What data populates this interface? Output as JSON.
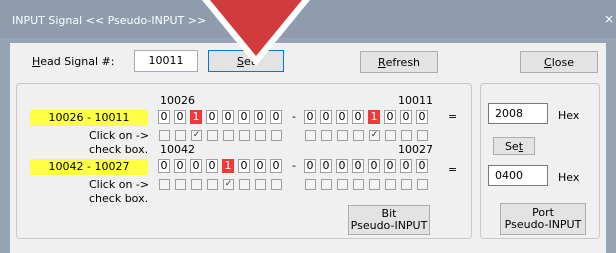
{
  "window": {
    "title": "INPUT Signal << Pseudo-INPUT >>",
    "close_glyph": "×"
  },
  "head": {
    "label_hot": "H",
    "label_rest": "ead Signal #:",
    "value": "10011",
    "set_hot": "S",
    "set_rest": "et",
    "refresh_hot": "R",
    "refresh_rest": "efresh",
    "close_hot": "C",
    "close_rest": "lose"
  },
  "rows": [
    {
      "range": "10026 - 10011",
      "left_label": "10026",
      "right_label": "10011",
      "bits_a": [
        "0",
        "0",
        "1",
        "0",
        "0",
        "0",
        "0",
        "0"
      ],
      "bits_b": [
        "0",
        "0",
        "0",
        "0",
        "1",
        "0",
        "0",
        "0"
      ],
      "on_a": [
        false,
        false,
        true,
        false,
        false,
        false,
        false,
        false
      ],
      "on_b": [
        false,
        false,
        false,
        false,
        true,
        false,
        false,
        false
      ],
      "checks_a": [
        false,
        false,
        true,
        false,
        false,
        false,
        false,
        false
      ],
      "checks_b": [
        false,
        false,
        false,
        false,
        true,
        false,
        false,
        false
      ],
      "hex": "2008"
    },
    {
      "range": "10042 - 10027",
      "left_label": "10042",
      "right_label": "10027",
      "bits_a": [
        "0",
        "0",
        "0",
        "0",
        "1",
        "0",
        "0",
        "0"
      ],
      "bits_b": [
        "0",
        "0",
        "0",
        "0",
        "0",
        "0",
        "0",
        "0"
      ],
      "on_a": [
        false,
        false,
        false,
        false,
        true,
        false,
        false,
        false
      ],
      "on_b": [
        false,
        false,
        false,
        false,
        false,
        false,
        false,
        false
      ],
      "checks_a": [
        false,
        false,
        false,
        false,
        true,
        false,
        false,
        false
      ],
      "checks_b": [
        false,
        false,
        false,
        false,
        false,
        false,
        false,
        false
      ],
      "hex": "0400"
    }
  ],
  "click_on": "Click on ->",
  "check_box": "check box.",
  "dash": "-",
  "equals": "=",
  "hex_unit": "Hex",
  "check_glyph": "✓",
  "set_hex_pre": "Se",
  "set_hex_hot": "t",
  "bit_button": {
    "line1": "Bit",
    "line2": "Pseudo-INPUT"
  },
  "port_button": {
    "line1": "Port",
    "line2": "Pseudo-INPUT"
  },
  "accent_color": "#ee3a3a",
  "range_color": "#ffff44"
}
